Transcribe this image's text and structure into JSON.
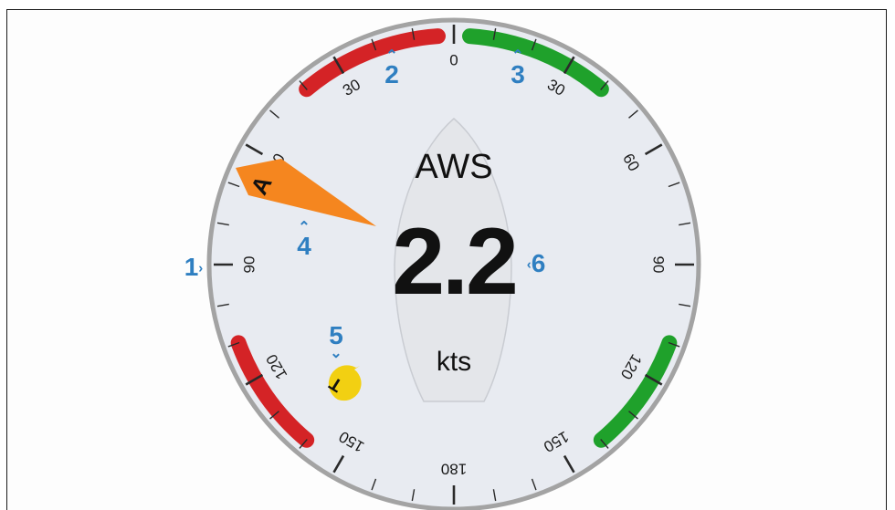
{
  "instrument": {
    "metric_label": "AWS",
    "value": "2.2",
    "unit": "kts"
  },
  "wind": {
    "apparent_marker_label": "A",
    "apparent_angle_deg": -62,
    "true_marker_label": "T",
    "true_angle_deg": -148
  },
  "scale": {
    "tick_labels": [
      {
        "angle": 0,
        "text": "0"
      },
      {
        "angle": 30,
        "text": "30"
      },
      {
        "angle": -30,
        "text": "30"
      },
      {
        "angle": 60,
        "text": "60"
      },
      {
        "angle": -60,
        "text": "60"
      },
      {
        "angle": 90,
        "text": "90"
      },
      {
        "angle": -90,
        "text": "90"
      },
      {
        "angle": 120,
        "text": "120"
      },
      {
        "angle": -120,
        "text": "120"
      },
      {
        "angle": 150,
        "text": "150"
      },
      {
        "angle": -150,
        "text": "150"
      },
      {
        "angle": 180,
        "text": "180"
      }
    ],
    "sectors": [
      {
        "from": -40,
        "to": -4,
        "color": "#d42326"
      },
      {
        "from": 4,
        "to": 40,
        "color": "#1fa12b"
      },
      {
        "from": -140,
        "to": -110,
        "color": "#d42326"
      },
      {
        "from": 110,
        "to": 140,
        "color": "#1fa12b"
      }
    ]
  },
  "callouts": {
    "c1": "1",
    "c2": "2",
    "c3": "3",
    "c4": "4",
    "c5": "5",
    "c6": "6"
  },
  "colors": {
    "dial_face": "#e8ebf1",
    "dial_rim": "#a3a3a3",
    "boat_fill": "#e4e6ea",
    "apparent_marker": "#f5861f",
    "true_marker": "#f2d012",
    "callout": "#2f7fc1"
  }
}
